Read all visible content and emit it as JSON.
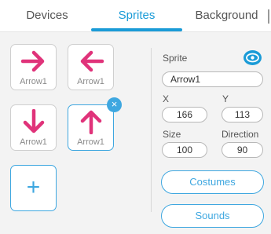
{
  "tabs": [
    {
      "label": "Devices",
      "active": false
    },
    {
      "label": "Sprites",
      "active": true
    },
    {
      "label": "Background",
      "active": false
    }
  ],
  "sprites": [
    {
      "name": "Arrow1",
      "icon": "arrow-right-icon",
      "selected": false
    },
    {
      "name": "Arrow1",
      "icon": "arrow-left-icon",
      "selected": false
    },
    {
      "name": "Arrow1",
      "icon": "arrow-down-icon",
      "selected": false
    },
    {
      "name": "Arrow1",
      "icon": "arrow-up-icon",
      "selected": true
    }
  ],
  "add_sprite_symbol": "+",
  "remove_symbol": "×",
  "properties": {
    "sprite_label": "Sprite",
    "sprite_name": "Arrow1",
    "x_label": "X",
    "x_value": "166",
    "y_label": "Y",
    "y_value": "113",
    "size_label": "Size",
    "size_value": "100",
    "direction_label": "Direction",
    "direction_value": "90"
  },
  "buttons": {
    "costumes": "Costumes",
    "sounds": "Sounds"
  },
  "colors": {
    "accent": "#1a9bd7",
    "arrow": "#e0337a"
  }
}
